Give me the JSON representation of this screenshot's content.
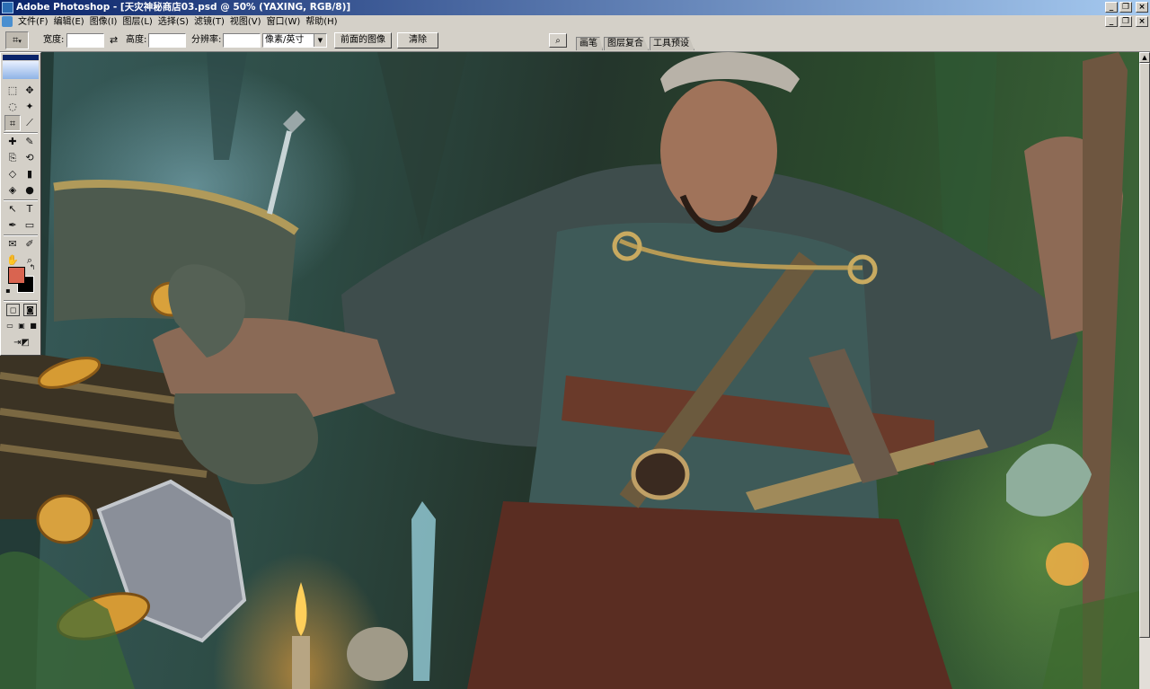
{
  "window": {
    "title": "Adobe Photoshop - [天灾神秘商店03.psd @ 50% (YAXING, RGB/8)]",
    "minimize_label": "_",
    "restore_label": "❐",
    "close_label": "×"
  },
  "menu": {
    "items": [
      "文件(F)",
      "编辑(E)",
      "图像(I)",
      "图层(L)",
      "选择(S)",
      "滤镜(T)",
      "视图(V)",
      "窗口(W)",
      "帮助(H)"
    ]
  },
  "options": {
    "width_label": "宽度:",
    "width_value": "",
    "swap_icon": "⇄",
    "height_label": "高度:",
    "height_value": "",
    "resolution_label": "分辨率:",
    "resolution_value": "",
    "unit_selected": "像素/英寸",
    "front_image_button": "前面的图像",
    "clear_button": "清除",
    "palette_tabs": [
      "画笔",
      "图层复合",
      "工具预设"
    ]
  },
  "toolbox": {
    "tools": [
      "⬚",
      "✥",
      "◌",
      "✦",
      "⌗",
      "⟋",
      "✚",
      "✎",
      "⎘",
      "⟲",
      "◇",
      "▮",
      "◈",
      "●",
      "↖",
      "T",
      "✒",
      "▭",
      "✉",
      "✐",
      "✋",
      "⌕"
    ],
    "foreground_color": "#d96450",
    "background_color": "#000000"
  }
}
